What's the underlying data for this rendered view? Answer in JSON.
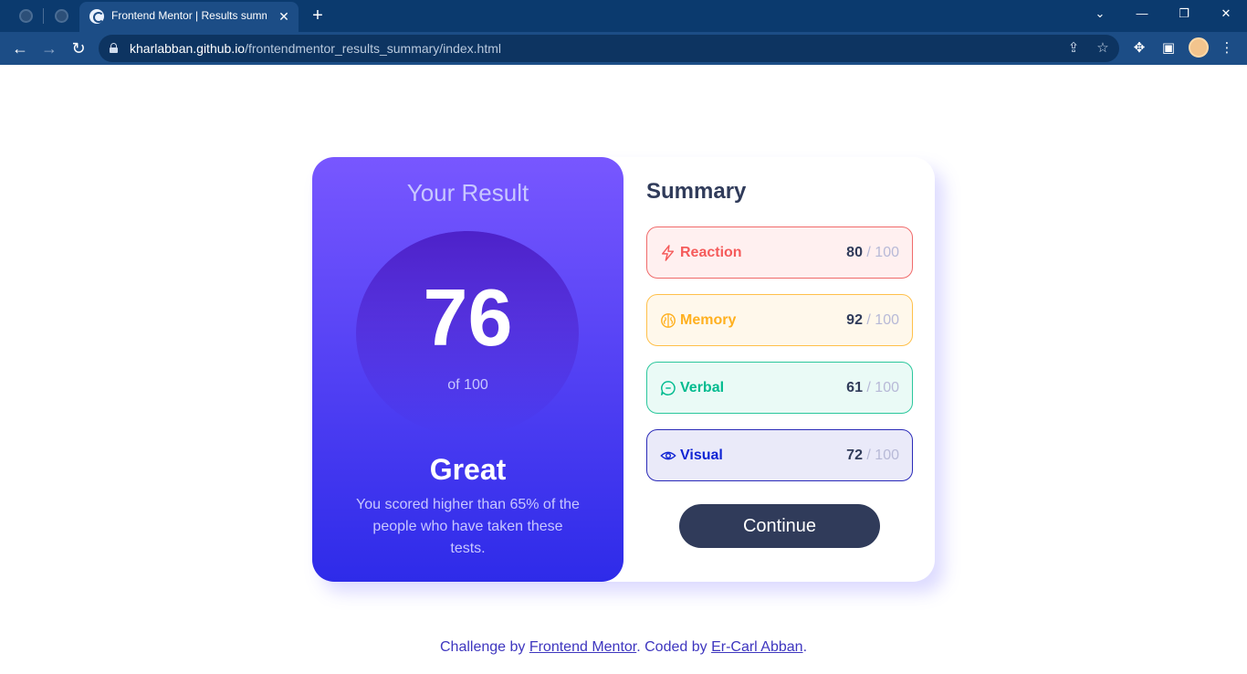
{
  "browser": {
    "tab_title": "Frontend Mentor | Results summary component",
    "url_host": "kharlabban.github.io",
    "url_path": "/frontendmentor_results_summary/index.html"
  },
  "result": {
    "heading": "Your Result",
    "score": "76",
    "score_of": "of 100",
    "grade": "Great",
    "description": "You scored higher than 65% of the people who have taken these tests."
  },
  "summary": {
    "title": "Summary",
    "items": [
      {
        "label": "Reaction",
        "score": "80",
        "max": " / 100",
        "icon": "lightning-icon",
        "color": "#f55b5b"
      },
      {
        "label": "Memory",
        "score": "92",
        "max": " / 100",
        "icon": "brain-icon",
        "color": "#ffb01f"
      },
      {
        "label": "Verbal",
        "score": "61",
        "max": " / 100",
        "icon": "chat-bubble-icon",
        "color": "#00bb8f"
      },
      {
        "label": "Visual",
        "score": "72",
        "max": " / 100",
        "icon": "eye-icon",
        "color": "#1125d4"
      }
    ],
    "continue_label": "Continue"
  },
  "attribution": {
    "prefix": "Challenge by ",
    "fm_link": "Frontend Mentor",
    "middle": ". Coded by ",
    "author_link": "Er-Carl Abban",
    "suffix": "."
  }
}
